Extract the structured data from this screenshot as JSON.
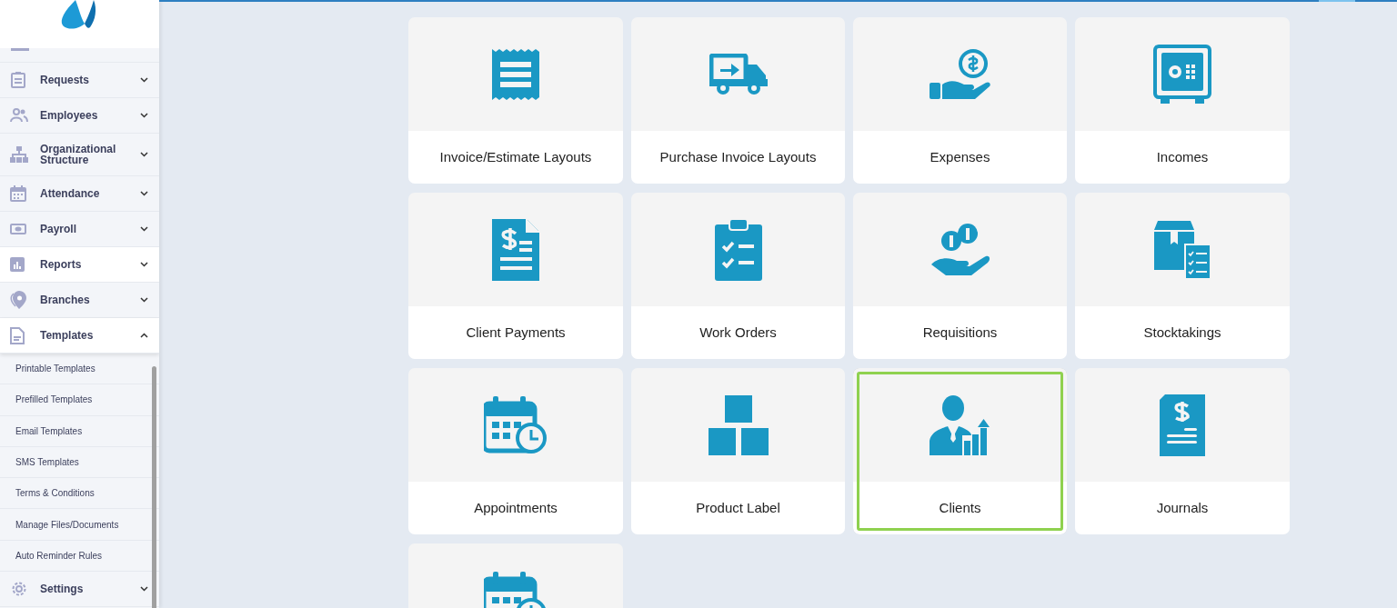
{
  "sidebar": {
    "items": [
      {
        "label": "Requests",
        "expanded": false,
        "hovered": false
      },
      {
        "label": "Employees",
        "expanded": false,
        "hovered": false
      },
      {
        "label": "Organizational Structure",
        "expanded": false,
        "hovered": false
      },
      {
        "label": "Attendance",
        "expanded": false,
        "hovered": false
      },
      {
        "label": "Payroll",
        "expanded": false,
        "hovered": false
      },
      {
        "label": "Reports",
        "expanded": false,
        "hovered": true
      },
      {
        "label": "Branches",
        "expanded": false,
        "hovered": false
      },
      {
        "label": "Templates",
        "expanded": true,
        "hovered": true,
        "children": [
          {
            "label": "Printable Templates"
          },
          {
            "label": "Prefilled Templates"
          },
          {
            "label": "Email Templates"
          },
          {
            "label": "SMS Templates"
          },
          {
            "label": "Terms & Conditions"
          },
          {
            "label": "Manage Files/Documents"
          },
          {
            "label": "Auto Reminder Rules"
          }
        ]
      },
      {
        "label": "Settings",
        "expanded": false,
        "hovered": false
      }
    ]
  },
  "cards": [
    {
      "label": "Invoice/Estimate Layouts",
      "selected": false
    },
    {
      "label": "Purchase Invoice Layouts",
      "selected": false
    },
    {
      "label": "Expenses",
      "selected": false
    },
    {
      "label": "Incomes",
      "selected": false
    },
    {
      "label": "Client Payments",
      "selected": false
    },
    {
      "label": "Work Orders",
      "selected": false
    },
    {
      "label": "Requisitions",
      "selected": false
    },
    {
      "label": "Stocktakings",
      "selected": false
    },
    {
      "label": "Appointments",
      "selected": false
    },
    {
      "label": "Product Label",
      "selected": false
    },
    {
      "label": "Clients",
      "selected": true
    },
    {
      "label": "Journals",
      "selected": false
    },
    {
      "kind": "cut",
      "selected": false
    }
  ]
}
